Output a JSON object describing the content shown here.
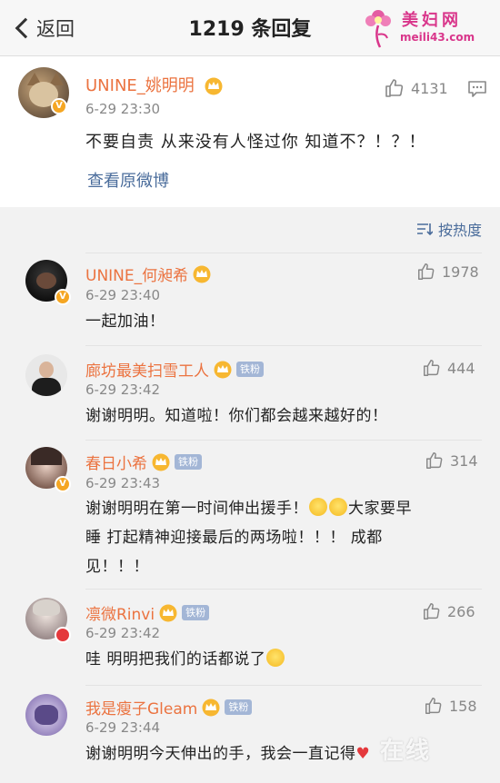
{
  "header": {
    "back_label": "返回",
    "title": "1219 条回复",
    "watermark_name": "美妇网",
    "watermark_url": "meili43.com"
  },
  "post": {
    "username": "UNINE_姚明明",
    "time": "6-29 23:30",
    "text": "不要自责 从来没有人怪过你  知道不？！？！",
    "view_original": "查看原微博",
    "likes": "4131",
    "badge": "V"
  },
  "sort": {
    "label": "按热度"
  },
  "comments": [
    {
      "username": "UNINE_何昶希",
      "time": "6-29 23:40",
      "text": "一起加油！",
      "likes": "1978",
      "fan_badge": ""
    },
    {
      "username": "廊坊最美扫雪工人",
      "time": "6-29 23:42",
      "text": "谢谢明明。知道啦！你们都会越来越好的！",
      "likes": "444",
      "fan_badge": "铁粉"
    },
    {
      "username": "春日小希",
      "time": "6-29 23:43",
      "text_1": "谢谢明明在第一时间伸出援手！",
      "text_2": "大家要早",
      "text_3": "睡 打起精神迎接最后的两场啦！！！ 成都",
      "text_4": "见！！！",
      "likes": "314",
      "fan_badge": "铁粉"
    },
    {
      "username": "凛微Rinvi",
      "time": "6-29 23:42",
      "text": "哇 明明把我们的话都说了",
      "likes": "266",
      "fan_badge": "铁粉"
    },
    {
      "username": "我是瘦子Gleam",
      "time": "6-29 23:44",
      "text": "谢谢明明今天伸出的手，我会一直记得",
      "likes": "158",
      "fan_badge": "铁粉"
    }
  ],
  "watermark_bottom": "在线",
  "colors": {
    "username": "#eb7340",
    "link": "#4a6c9b",
    "fan_badge": "#a3b6d6",
    "verified": "#f5a623"
  }
}
